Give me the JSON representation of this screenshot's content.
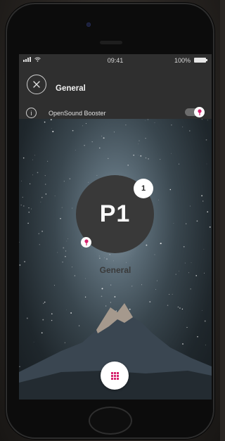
{
  "status_bar": {
    "time": "09:41",
    "battery": "100%"
  },
  "header": {
    "title": "General",
    "close_icon": "close-icon"
  },
  "booster": {
    "label": "OpenSound Booster",
    "enabled": true,
    "info_icon": "info-icon"
  },
  "program": {
    "label": "P1",
    "badge_count": "1",
    "name": "General"
  },
  "colors": {
    "accent": "#d6246e",
    "header_bg": "#2f2f2f",
    "program_circle": "#393939"
  },
  "icons": {
    "menu": "grid-icon",
    "pin": "pin-icon",
    "toggle_knob": "pin-icon"
  }
}
